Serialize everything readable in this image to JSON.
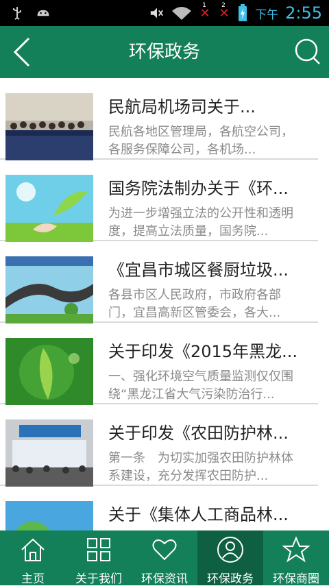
{
  "statusbar": {
    "ampm": "下午",
    "time": "2:55",
    "sim1": "1",
    "sim2": "2"
  },
  "header": {
    "title": "环保政务"
  },
  "articles": [
    {
      "title": "民航局机场司关于...",
      "desc": "民航各地区管理局，各航空公司，各服务保障公司，各机场..."
    },
    {
      "title": "国务院法制办关于《环...",
      "desc": "为进一步增强立法的公开性和透明度，提高立法质量，国务院..."
    },
    {
      "title": "《宜昌市城区餐厨垃圾...",
      "desc": "各县市区人民政府，市政府各部门，宜昌高新区管委会，各大..."
    },
    {
      "title": "关于印发《2015年黑龙...",
      "desc": "一、强化环境空气质量监测仅仅围绕“黑龙江省大气污染防治行..."
    },
    {
      "title": "关于印发《农田防护林...",
      "desc": "第一条　为切实加强农田防护林体系建设，充分发挥农田防护..."
    },
    {
      "title": "关于《集体人工商品林...",
      "desc": ""
    }
  ],
  "tabs": [
    {
      "label": "主页",
      "icon": "home-icon"
    },
    {
      "label": "关于我们",
      "icon": "grid-icon"
    },
    {
      "label": "环保资讯",
      "icon": "heart-icon"
    },
    {
      "label": "环保政务",
      "icon": "user-icon"
    },
    {
      "label": "环保商圈",
      "icon": "star-icon"
    }
  ],
  "colors": {
    "primary": "#14805a",
    "active_tab": "#0f5f42",
    "time": "#3fc0e8"
  }
}
